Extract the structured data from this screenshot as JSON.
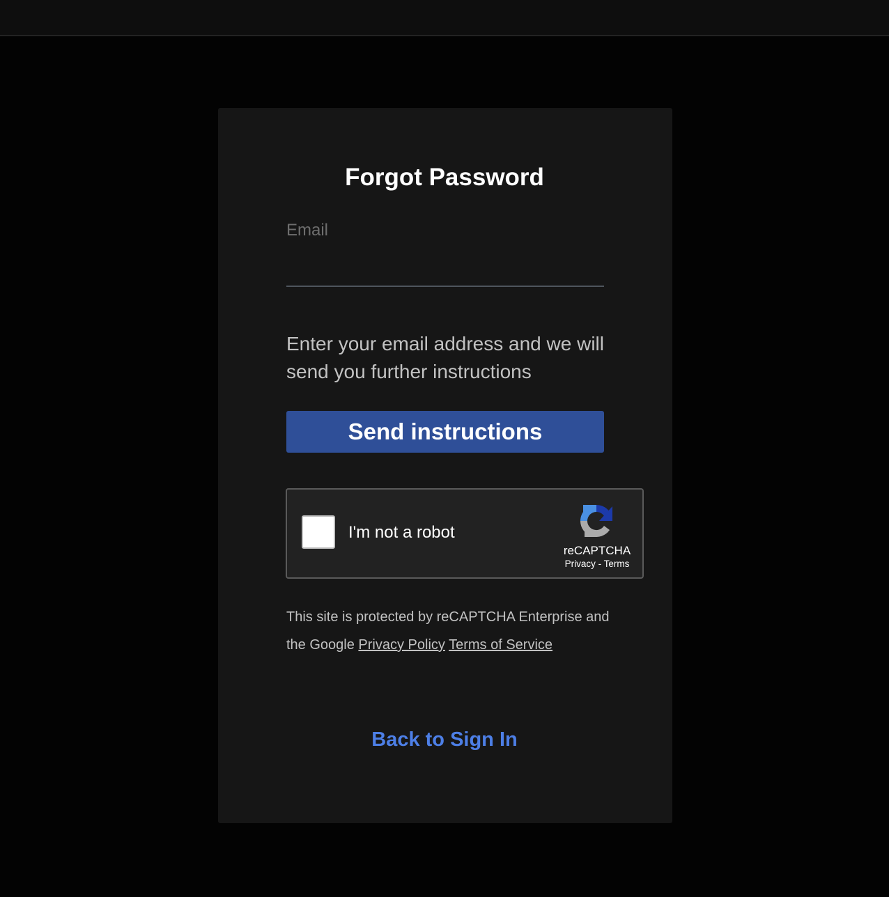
{
  "page": {
    "title": "Forgot Password"
  },
  "form": {
    "email_label": "Email",
    "email_value": "",
    "helper_text": "Enter your email address and we will send you further instructions",
    "submit_label": "Send instructions"
  },
  "captcha": {
    "checkbox_label": "I'm not a robot",
    "brand": "reCAPTCHA",
    "privacy_link": "Privacy",
    "separator": "-",
    "terms_link": "Terms",
    "logo_icon": "recaptcha-icon"
  },
  "notice": {
    "text_prefix": "This site is protected by reCAPTCHA Enterprise and the Google",
    "privacy_link": "Privacy Policy",
    "terms_link": "Terms of Service"
  },
  "footer": {
    "back_link": "Back to Sign In"
  },
  "colors": {
    "page_background": "#030303",
    "card_background": "#161616",
    "primary_button": "#2f4f98",
    "link": "#4d7fe6"
  }
}
